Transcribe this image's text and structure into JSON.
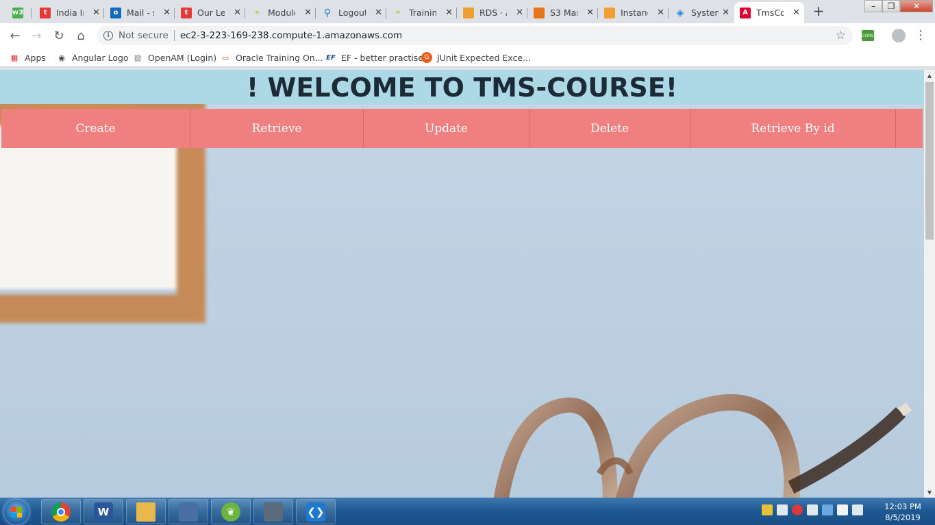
{
  "browser": {
    "tabs": [
      {
        "label": "",
        "icon": "w3schools-icon",
        "color": "#4caf50"
      },
      {
        "label": "India In",
        "icon": "t-favicon-icon",
        "color": "#e53935"
      },
      {
        "label": "Mail - s",
        "icon": "outlook-icon",
        "color": "#0f6cbd"
      },
      {
        "label": "Our Le",
        "icon": "t-favicon-icon",
        "color": "#e53935"
      },
      {
        "label": "Module",
        "icon": "leaf-icon",
        "color": "#c0ca33"
      },
      {
        "label": "Logout",
        "icon": "jira-icon",
        "color": "#1e7fc8"
      },
      {
        "label": "Trainin",
        "icon": "leaf-icon",
        "color": "#c0ca33"
      },
      {
        "label": "RDS · A",
        "icon": "aws-cube-icon",
        "color": "#f0a030"
      },
      {
        "label": "S3 Man",
        "icon": "aws-cube-icon",
        "color": "#e8751a"
      },
      {
        "label": "Instanc",
        "icon": "aws-cube-icon",
        "color": "#f0a030"
      },
      {
        "label": "System",
        "icon": "layers-icon",
        "color": "#1e88e5"
      },
      {
        "label": "TmsCo",
        "icon": "angular-icon",
        "color": "#dd0031"
      }
    ],
    "address": {
      "security_label": "Not secure",
      "url": "ec2-3-223-169-238.compute-1.amazonaws.com"
    },
    "extension_label": "CORS",
    "bookmarks": [
      {
        "label": "Apps",
        "icon": "apps-grid-icon"
      },
      {
        "label": "Angular Logo",
        "icon": "globe-icon"
      },
      {
        "label": "OpenAM (Login)",
        "icon": "openam-icon"
      },
      {
        "label": "Oracle Training On...",
        "icon": "oracle-icon"
      },
      {
        "label": "EF - better practise",
        "icon": "ef-icon"
      },
      {
        "label": "JUnit Expected Exce...",
        "icon": "junit-icon"
      }
    ]
  },
  "page": {
    "heading": "! WELCOME TO TMS-COURSE!",
    "menu": [
      "Create",
      "Retrieve",
      "Update",
      "Delete",
      "Retrieve By id"
    ]
  },
  "taskbar": {
    "apps": [
      {
        "name": "chrome-icon",
        "color": "#db4437"
      },
      {
        "name": "word-icon",
        "color": "#2b579a",
        "glyph": "W"
      },
      {
        "name": "file-explorer-icon",
        "color": "#e8b84a"
      },
      {
        "name": "network-tool-icon",
        "color": "#4a6fa5"
      },
      {
        "name": "spring-tool-suite-icon",
        "color": "#6db33f"
      },
      {
        "name": "lock-tool-icon",
        "color": "#5a6b7b"
      },
      {
        "name": "vscode-icon",
        "color": "#1f7acc"
      }
    ],
    "clock": {
      "time": "12:03 PM",
      "date": "8/5/2019"
    }
  }
}
